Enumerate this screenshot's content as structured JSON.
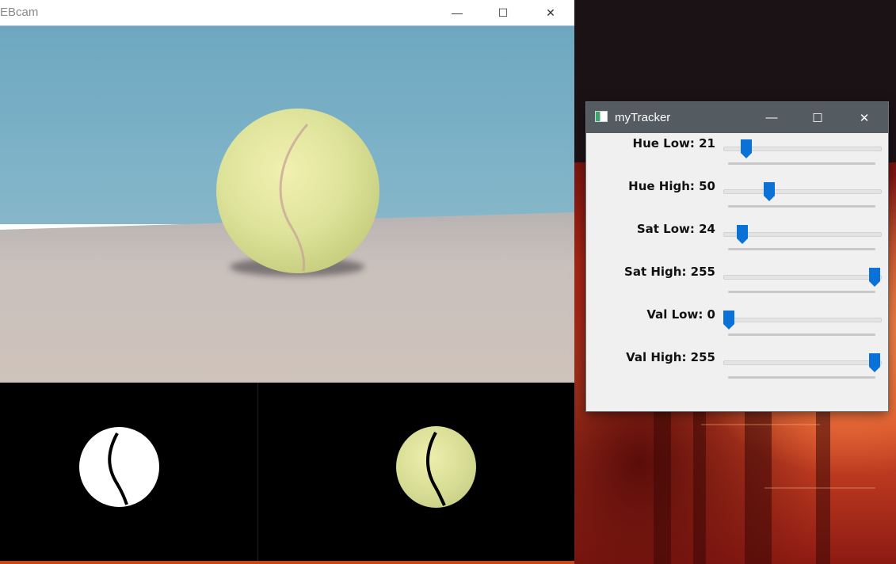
{
  "webcam_window": {
    "title": "EBcam",
    "buttons": {
      "minimize": "—",
      "maximize": "☐",
      "close": "✕"
    }
  },
  "tracker_window": {
    "title": "myTracker",
    "buttons": {
      "minimize": "—",
      "maximize": "☐",
      "close": "✕"
    },
    "sliders": [
      {
        "label": "Hue Low: 21",
        "value": 21,
        "max": 179
      },
      {
        "label": "Hue High: 50",
        "value": 50,
        "max": 179
      },
      {
        "label": "Sat Low: 24",
        "value": 24,
        "max": 255
      },
      {
        "label": "Sat High: 255",
        "value": 255,
        "max": 255
      },
      {
        "label": "Val Low: 0",
        "value": 0,
        "max": 255
      },
      {
        "label": "Val High: 255",
        "value": 255,
        "max": 255
      }
    ],
    "accent_color": "#0a72d6"
  }
}
